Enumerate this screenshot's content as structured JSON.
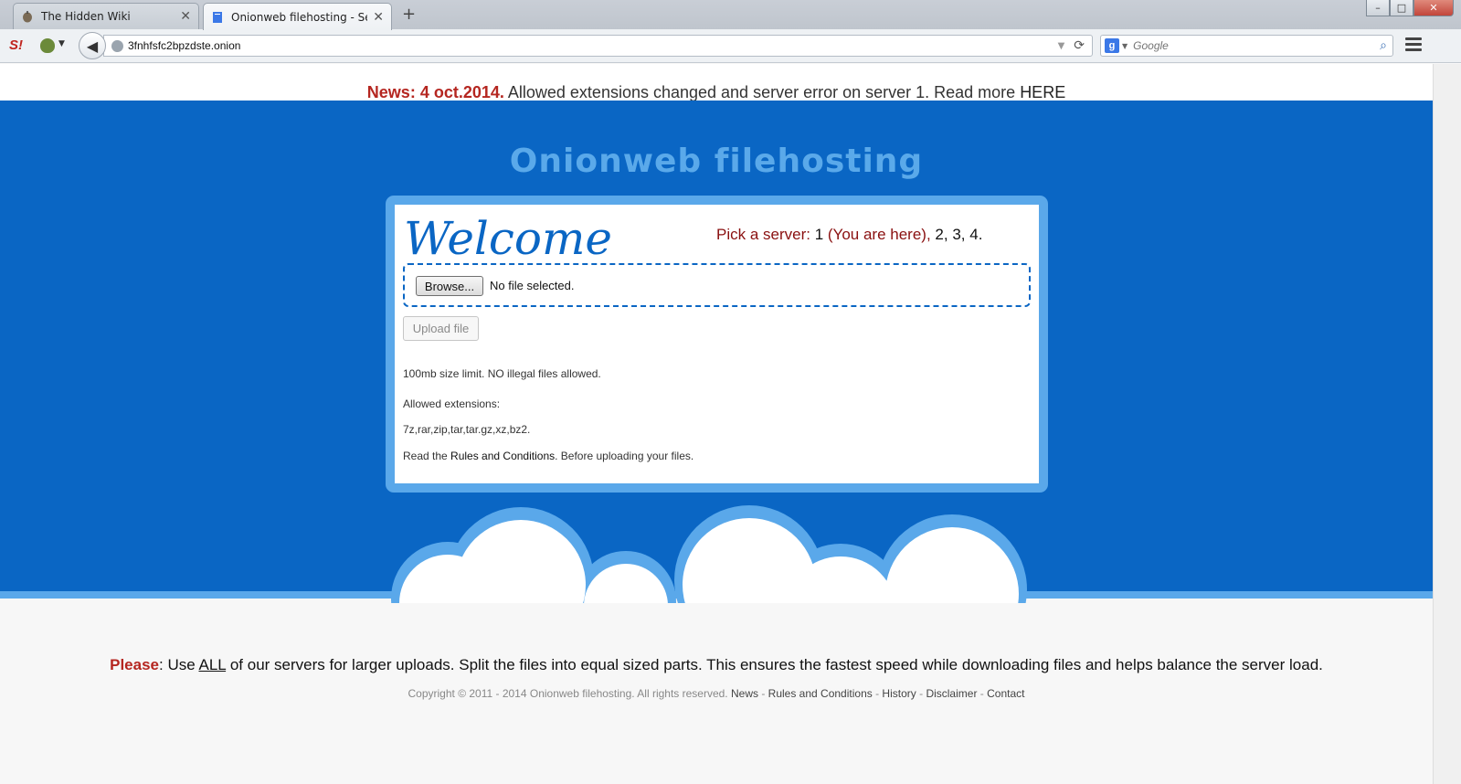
{
  "browser": {
    "tabs": [
      {
        "title": "The Hidden Wiki",
        "active": false
      },
      {
        "title": "Onionweb filehosting - Ser...",
        "active": true
      }
    ],
    "new_tab": "+",
    "window_controls": {
      "minimize": "–",
      "maximize": "□",
      "close": "✕"
    },
    "url": "3fnhfsfc2bpzdste.onion",
    "search_placeholder": "Google",
    "back_icon": "back-arrow-icon"
  },
  "news": {
    "label": "News: 4 oct.2014.",
    "text": " Allowed extensions changed and server error on server 1. Read more ",
    "link": "HERE"
  },
  "site_title": "Onionweb filehosting",
  "panel": {
    "welcome": "Welcome",
    "pick_label": "Pick a server: ",
    "server_1": "1",
    "you_are_here": " (You are here), ",
    "server_2": "2",
    "server_3": "3",
    "server_4": "4",
    "browse_label": "Browse...",
    "no_file": "No file selected.",
    "upload_label": "Upload file",
    "size_limit": "100mb size limit. NO illegal files allowed.",
    "allowed_label": "Allowed extensions:",
    "extensions": "7z,rar,zip,tar,tar.gz,xz,bz2.",
    "rules_prefix": "Read the ",
    "rules_link": "Rules and Conditions",
    "rules_suffix": ". Before uploading your files."
  },
  "footer": {
    "please_label": "Please",
    "please_pre": ": Use ",
    "please_all": "ALL",
    "please_post": " of our servers for larger uploads. Split the files into equal sized parts. This ensures the fastest speed while downloading files and helps balance the server load.",
    "copyright": "Copyright © 2011 - 2014 Onionweb filehosting. All rights reserved. ",
    "links": [
      "News",
      "Rules and Conditions",
      "History",
      "Disclaimer",
      "Contact"
    ],
    "sep": " - "
  },
  "colors": {
    "blue": "#0a66c4",
    "light_blue": "#5aa8ea",
    "red": "#b52620"
  }
}
